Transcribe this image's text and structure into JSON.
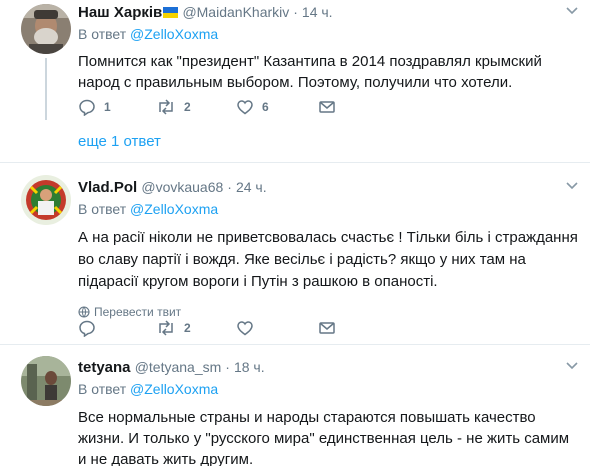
{
  "replies_label": "Ответ",
  "tweets": [
    {
      "name": "Наш Харків",
      "handle": "@MaidanKharkiv",
      "dot": "·",
      "time": "14 ч.",
      "reply_prefix": "В ответ",
      "reply_mention": "@ZelloXoxma",
      "text": "Помнится как \"президент\" Казантипа в 2014 поздравлял крымский народ с правильным выбором. Поэтому, получили что хотели.",
      "counts": {
        "reply": "1",
        "retweet": "2",
        "like": "6"
      }
    },
    {
      "name": "Vlad.Pol",
      "handle": "@vovkaua68",
      "dot": "·",
      "time": "24 ч.",
      "reply_prefix": "В ответ",
      "reply_mention": "@ZelloXoxma",
      "text": "А на расії ніколи не приветсвовалась счастьє ! Тільки біль і страждання во славу партії і вождя. Яке весільє і радість?  якщо у них там на підарасії кругом вороги і Путін з рашкою в опаності.",
      "translate": "Перевести твит",
      "counts": {
        "reply": "",
        "retweet": "2",
        "like": ""
      }
    },
    {
      "name": "tetyana",
      "handle": "@tetyana_sm",
      "dot": "·",
      "time": "18 ч.",
      "reply_prefix": "В ответ",
      "reply_mention": "@ZelloXoxma",
      "text": "Все нормальные страны и народы стараются повышать качество жизни. И только у \"русского мира\" единственная цель - не жить самим и не давать жить другим."
    }
  ],
  "more_replies": "еще 1 ответ",
  "colors": {
    "link": "#1da1f2",
    "muted": "#657786",
    "text": "#14171a",
    "divider": "#e6ecf0",
    "thread_line": "#ccd6dd"
  },
  "icons": [
    "reply-icon",
    "retweet-icon",
    "like-icon",
    "dm-icon",
    "chevron-down-icon",
    "globe-icon",
    "ukraine-flag-icon"
  ]
}
